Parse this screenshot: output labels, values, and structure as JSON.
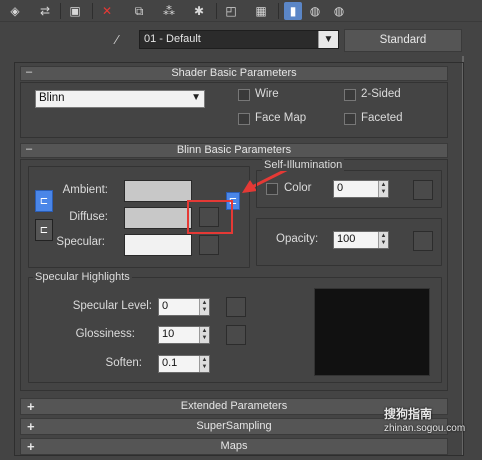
{
  "toolbar": {
    "icons": [
      "get-material-icon",
      "put-material-icon",
      "assign-icon",
      "reset-icon",
      "make-unique-icon",
      "put-library-icon",
      "material-effects-icon",
      "show-map-icon",
      "show-end-result-icon",
      "go-to-parent-icon",
      "go-forward-icon"
    ]
  },
  "material": {
    "name": "01 - Default",
    "type": "Standard"
  },
  "shader_basic": {
    "title": "Shader Basic Parameters",
    "collapse_sign": "–",
    "shader": "Blinn",
    "wire_label": "Wire",
    "two_sided_label": "2-Sided",
    "face_map_label": "Face Map",
    "faceted_label": "Faceted"
  },
  "blinn_basic": {
    "title": "Blinn Basic Parameters",
    "collapse_sign": "–",
    "ambient_label": "Ambient:",
    "diffuse_label": "Diffuse:",
    "specular_label": "Specular:",
    "self_illum_title": "Self-Illumination",
    "color_label": "Color",
    "color_value": "0",
    "opacity_label": "Opacity:",
    "opacity_value": "100",
    "ambient_color": "#c8c8c8",
    "diffuse_color": "#c8c8c8",
    "specular_color": "#f2f2f2"
  },
  "specular_highlights": {
    "title": "Specular Highlights",
    "level_label": "Specular Level:",
    "level_value": "0",
    "gloss_label": "Glossiness:",
    "gloss_value": "10",
    "soften_label": "Soften:",
    "soften_value": "0.1"
  },
  "rollouts": [
    {
      "sign": "+",
      "label": "Extended Parameters"
    },
    {
      "sign": "+",
      "label": "SuperSampling"
    },
    {
      "sign": "+",
      "label": "Maps"
    }
  ],
  "watermark": {
    "brand": "搜狗指南",
    "url": "zhinan.sogou.com"
  },
  "colors": {
    "accent": "#4a86e8",
    "highlight": "#e53935"
  }
}
